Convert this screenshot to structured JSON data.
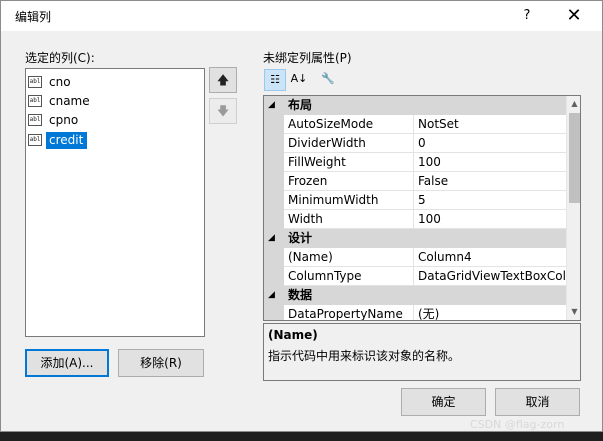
{
  "window": {
    "title": "编辑列",
    "help_glyph": "?",
    "close_glyph": "✕"
  },
  "selected_columns": {
    "label": "选定的列(C):",
    "items": [
      {
        "label": "cno",
        "icon": "textbox-column-icon"
      },
      {
        "label": "cname",
        "icon": "textbox-column-icon"
      },
      {
        "label": "cpno",
        "icon": "textbox-column-icon"
      },
      {
        "label": "credit",
        "icon": "textbox-column-icon",
        "selected": true
      }
    ],
    "icon_text": "abl",
    "move_up_glyph": "🡅",
    "move_down_glyph": "🡇"
  },
  "buttons": {
    "add": "添加(A)...",
    "remove": "移除(R)",
    "ok": "确定",
    "cancel": "取消"
  },
  "properties": {
    "label": "未绑定列属性(P)",
    "toolbar": {
      "categorized_glyph": "☷",
      "alphabetical_glyph": "A↓",
      "pages_glyph": "🔧"
    },
    "categories": [
      {
        "name": "布局",
        "toggle": "◢",
        "rows": [
          {
            "name": "AutoSizeMode",
            "value": "NotSet"
          },
          {
            "name": "DividerWidth",
            "value": "0"
          },
          {
            "name": "FillWeight",
            "value": "100"
          },
          {
            "name": "Frozen",
            "value": "False"
          },
          {
            "name": "MinimumWidth",
            "value": "5"
          },
          {
            "name": "Width",
            "value": "100"
          }
        ]
      },
      {
        "name": "设计",
        "toggle": "◢",
        "rows": [
          {
            "name": "(Name)",
            "value": "Column4"
          },
          {
            "name": "ColumnType",
            "value": "DataGridViewTextBoxColu"
          }
        ]
      },
      {
        "name": "数据",
        "toggle": "◢",
        "rows": [
          {
            "name": "DataPropertyName",
            "value": "(无)"
          }
        ]
      }
    ],
    "scroll_up_glyph": "▲",
    "scroll_down_glyph": "▼"
  },
  "description": {
    "title": "(Name)",
    "text": "指示代码中用来标识该对象的名称。"
  },
  "watermark": "CSDN @flag-zorn"
}
